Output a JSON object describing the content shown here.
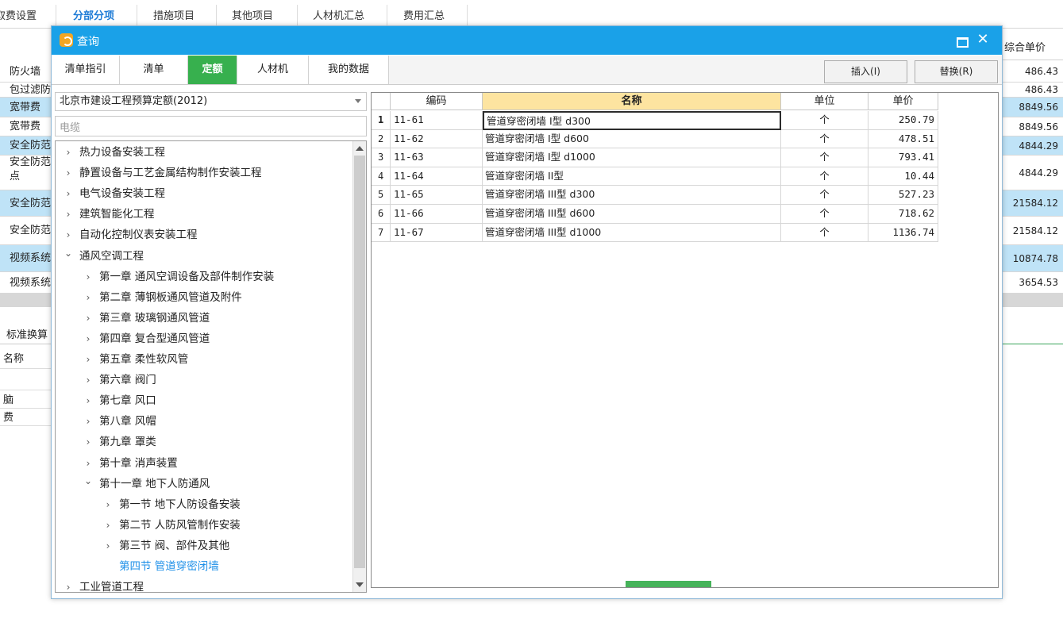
{
  "top_tabs": [
    "取费设置",
    "分部分项",
    "措施项目",
    "其他项目",
    "人材机汇总",
    "费用汇总"
  ],
  "top_tab_active": "分部分项",
  "bg_header_right": "综合单价",
  "bg_rows": [
    {
      "left": "防火墙",
      "right": "486.43",
      "style": "plain"
    },
    {
      "left": "包过滤防",
      "right": "486.43",
      "style": "plain"
    },
    {
      "left": "宽带费",
      "right": "8849.56",
      "style": "blue"
    },
    {
      "left": "宽带费",
      "right": "8849.56",
      "style": "plain"
    },
    {
      "left": "安全防范",
      "right": "4844.29",
      "style": "blue"
    },
    {
      "left": "安全防范点",
      "right": "4844.29",
      "style": "plain"
    },
    {
      "left": "安全防范",
      "right": "21584.12",
      "style": "blue"
    },
    {
      "left": "安全防范",
      "right": "21584.12",
      "style": "plain"
    },
    {
      "left": "视频系统",
      "right": "10874.78",
      "style": "blue"
    },
    {
      "left": "视频系统",
      "right": "3654.53",
      "style": "plain"
    }
  ],
  "lower_tab": "标准换算",
  "lower_rows": [
    "名称",
    "",
    "脑",
    "费"
  ],
  "dialog": {
    "title": "查询",
    "tabs": [
      "清单指引",
      "清单",
      "定额",
      "人材机",
      "我的数据"
    ],
    "active_tab": "定额",
    "insert_label": "插入(I)",
    "replace_label": "替换(R)",
    "quota_select": "北京市建设工程预算定额(2012)",
    "search_value": "电缆",
    "tree": [
      {
        "label": "热力设备安装工程",
        "level": 0,
        "chev": "›"
      },
      {
        "label": "静置设备与工艺金属结构制作安装工程",
        "level": 0,
        "chev": "›"
      },
      {
        "label": "电气设备安装工程",
        "level": 0,
        "chev": "›"
      },
      {
        "label": "建筑智能化工程",
        "level": 0,
        "chev": "›"
      },
      {
        "label": "自动化控制仪表安装工程",
        "level": 0,
        "chev": "›"
      },
      {
        "label": "通风空调工程",
        "level": 0,
        "chev": "⌄"
      },
      {
        "label": "第一章 通风空调设备及部件制作安装",
        "level": 1,
        "chev": "›"
      },
      {
        "label": "第二章 薄钢板通风管道及附件",
        "level": 1,
        "chev": "›"
      },
      {
        "label": "第三章 玻璃钢通风管道",
        "level": 1,
        "chev": "›"
      },
      {
        "label": "第四章 复合型通风管道",
        "level": 1,
        "chev": "›"
      },
      {
        "label": "第五章 柔性软风管",
        "level": 1,
        "chev": "›"
      },
      {
        "label": "第六章 阀门",
        "level": 1,
        "chev": "›"
      },
      {
        "label": "第七章 风口",
        "level": 1,
        "chev": "›"
      },
      {
        "label": "第八章 风帽",
        "level": 1,
        "chev": "›"
      },
      {
        "label": "第九章 罩类",
        "level": 1,
        "chev": "›"
      },
      {
        "label": "第十章 消声装置",
        "level": 1,
        "chev": "›"
      },
      {
        "label": "第十一章 地下人防通风",
        "level": 1,
        "chev": "⌄"
      },
      {
        "label": "第一节 地下人防设备安装",
        "level": 2,
        "chev": "›"
      },
      {
        "label": "第二节 人防风管制作安装",
        "level": 2,
        "chev": "›"
      },
      {
        "label": "第三节 阀、部件及其他",
        "level": 2,
        "chev": "›"
      },
      {
        "label": "第四节 管道穿密闭墙",
        "level": 2,
        "chev": "",
        "selected": true
      },
      {
        "label": "工业管道工程",
        "level": 0,
        "chev": "›"
      }
    ],
    "grid": {
      "headers": [
        "",
        "编码",
        "名称",
        "单位",
        "单价"
      ],
      "rows": [
        {
          "idx": "1",
          "code": "11-61",
          "name": "管道穿密闭墙 I型 d300",
          "unit": "个",
          "price": "250.79"
        },
        {
          "idx": "2",
          "code": "11-62",
          "name": "管道穿密闭墙 I型 d600",
          "unit": "个",
          "price": "478.51"
        },
        {
          "idx": "3",
          "code": "11-63",
          "name": "管道穿密闭墙 I型 d1000",
          "unit": "个",
          "price": "793.41"
        },
        {
          "idx": "4",
          "code": "11-64",
          "name": "管道穿密闭墙 II型",
          "unit": "个",
          "price": "10.44"
        },
        {
          "idx": "5",
          "code": "11-65",
          "name": "管道穿密闭墙 III型 d300",
          "unit": "个",
          "price": "527.23"
        },
        {
          "idx": "6",
          "code": "11-66",
          "name": "管道穿密闭墙 III型 d600",
          "unit": "个",
          "price": "718.62"
        },
        {
          "idx": "7",
          "code": "11-67",
          "name": "管道穿密闭墙 III型 d1000",
          "unit": "个",
          "price": "1136.74"
        }
      ]
    }
  },
  "colors": {
    "title_bar": "#1aa1e8",
    "active_tab": "#37b04e",
    "header_highlight": "#fde4a0",
    "selected_tree": "#1e90e8"
  }
}
